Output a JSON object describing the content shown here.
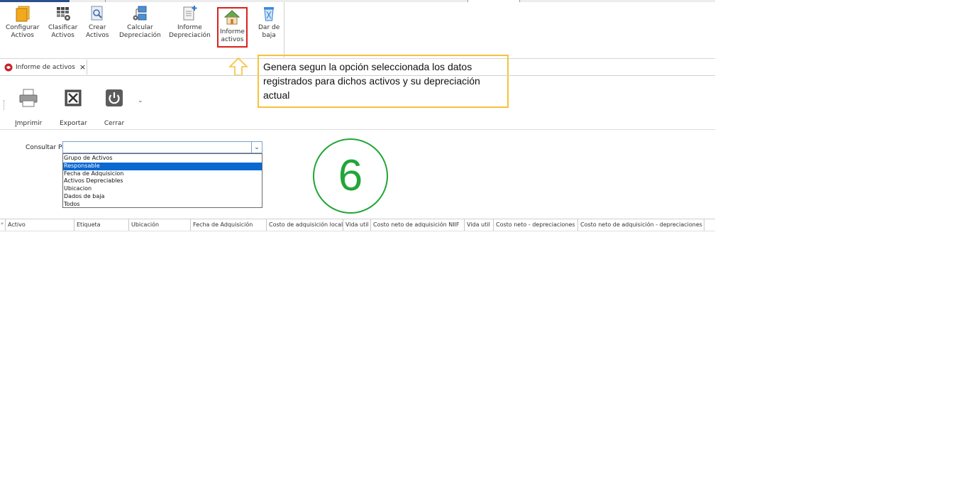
{
  "ribbon": {
    "buttons": [
      {
        "label": "Configurar\nActivos",
        "icon": "folder-stack-icon"
      },
      {
        "label": "Clasificar\nActivos",
        "icon": "grid-gear-icon"
      },
      {
        "label": "Crear\nActivos",
        "icon": "document-search-icon"
      },
      {
        "label": "Calcular\nDepreciación",
        "icon": "network-gear-icon"
      },
      {
        "label": "Informe\nDepreciación",
        "icon": "document-add-icon"
      },
      {
        "label": "Informe\nactivos",
        "icon": "house-icon",
        "selected": true
      },
      {
        "label": "Dar de\nbaja",
        "icon": "recycle-bin-icon"
      }
    ]
  },
  "tab": {
    "label": "Informe de activos",
    "close": "×"
  },
  "toolbar": {
    "print_label_underline": "I",
    "print_label_rest": "mprimir",
    "export_label": "Exportar",
    "close_label": "Cerrar",
    "more_glyph": "⌄"
  },
  "filter": {
    "label": "Consultar Por:",
    "value": "",
    "options": [
      "Grupo de Activos",
      "Responsable",
      "Fecha de Adquisicion",
      "Activos Depreciables",
      "Ubicacion",
      "Dados de baja",
      "Todos"
    ],
    "highlighted_index": 1
  },
  "callout": {
    "text": "Genera segun la opción seleccionada los datos registrados para dichos activos y su depreciación actual"
  },
  "step_number": "6",
  "grid": {
    "row_marker": "*",
    "columns": [
      "Activo",
      "Etiqueta",
      "Ubicación",
      "Fecha de Adquisición",
      "Costo de adquisición local",
      "Vida util",
      "Costo neto de adquisición NIIF",
      "Vida util",
      "Costo neto - depreciaciones",
      "Costo neto de adquisición - depreciaciones"
    ]
  },
  "colors": {
    "accent": "#2b4f8c",
    "selection_border": "#d9221f",
    "callout_border": "#f7c23a",
    "step_circle": "#22a637",
    "list_highlight": "#0a68d1"
  }
}
